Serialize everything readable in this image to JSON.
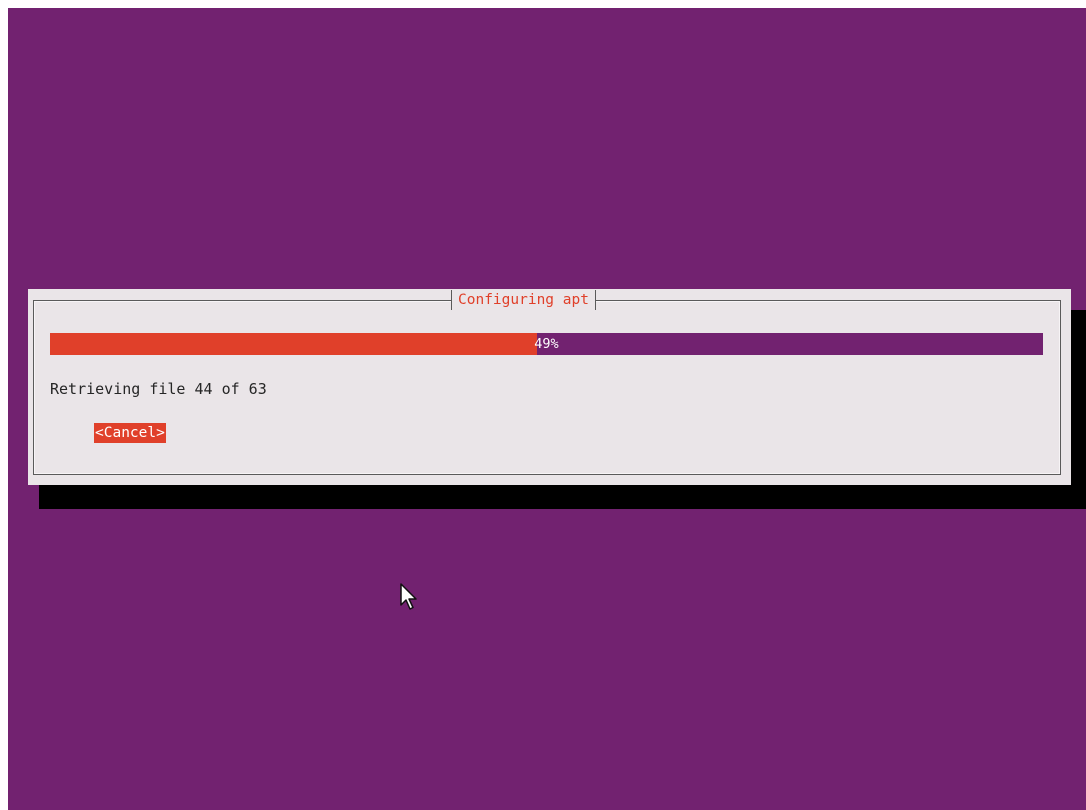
{
  "dialog": {
    "title": "Configuring apt",
    "progress": {
      "percent": 49,
      "label": "49%"
    },
    "status": "Retrieving file 44 of 63",
    "cancel_label": "<Cancel>"
  },
  "icons": {
    "cursor": "mouse-pointer-icon"
  },
  "colors": {
    "background": "#722270",
    "dialog": "#eae5e8",
    "accent": "#e0402a",
    "shadow": "#000000"
  }
}
